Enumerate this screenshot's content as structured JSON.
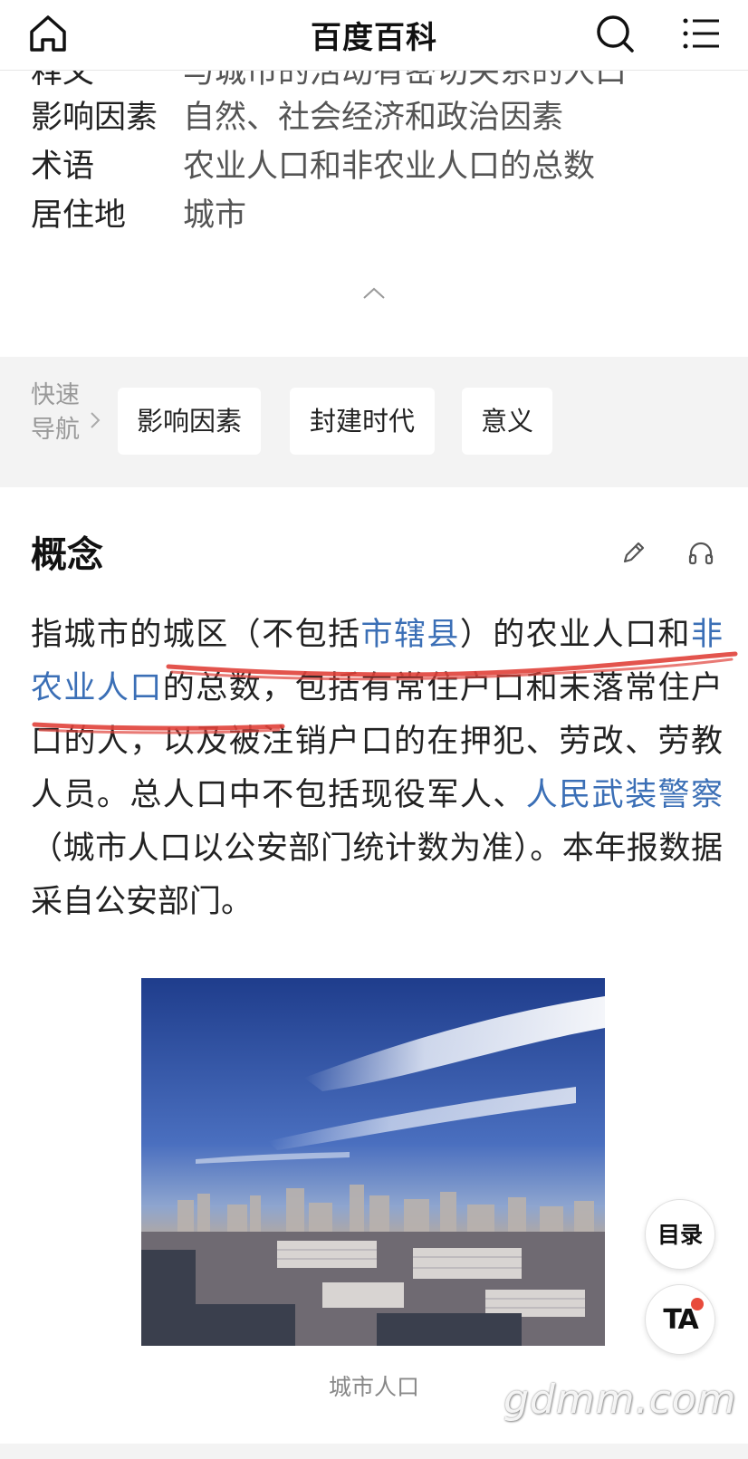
{
  "header": {
    "title": "百度百科",
    "home_icon": "home-icon",
    "search_icon": "search-icon",
    "menu_icon": "menu-icon"
  },
  "infobox": {
    "cut_row": {
      "key": "释义",
      "value": "与城市的活动有密切关系的人口"
    },
    "rows": [
      {
        "key": "影响因素",
        "value": "自然、社会经济和政治因素"
      },
      {
        "key": "术语",
        "value": "农业人口和非农业人口的总数"
      },
      {
        "key": "居住地",
        "value": "城市"
      }
    ],
    "collapse_icon": "chevron-up-icon"
  },
  "quicknav": {
    "label_line1": "快速",
    "label_line2": "导航",
    "chips": [
      "影响因素",
      "封建时代",
      "意义"
    ]
  },
  "section": {
    "title": "概念",
    "edit_icon": "pencil-icon",
    "listen_icon": "headphones-icon",
    "paragraph": {
      "p1": "指城市的城区（不包括",
      "link1": "市辖县",
      "p2": "）的农业人口和",
      "link2": "非农业人口",
      "p3": "的总数，包括有常住户口和未落常住户口的人，以及被注销户口的在押犯、劳改、劳教人员。总人口中不包括现役军人、",
      "link3": "人民武装警察",
      "p4": "（城市人口以公安部门统计数为准）。本年报数据采自公安部门。"
    },
    "image_caption": "城市人口"
  },
  "fabs": {
    "toc": "目录",
    "ta": "TA"
  },
  "watermark": "gdmm.com",
  "colors": {
    "link": "#3b6fb6",
    "scribble": "#e0413a",
    "notification_dot": "#e84b3c"
  }
}
